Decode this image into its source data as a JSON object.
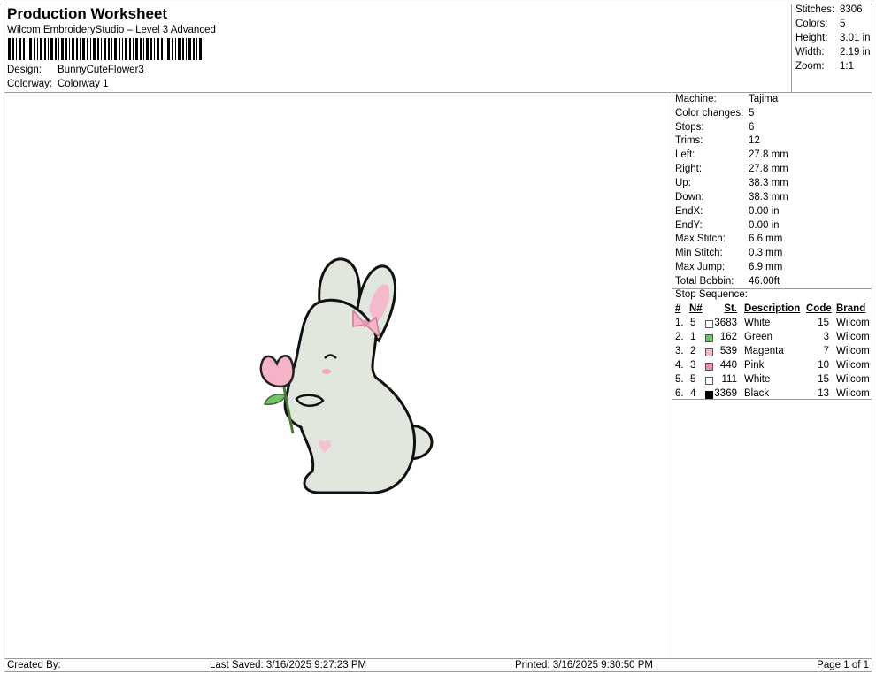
{
  "header": {
    "title": "Production Worksheet",
    "subtitle": "Wilcom EmbroideryStudio – Level 3 Advanced",
    "design_label": "Design:",
    "design_value": "BunnyCuteFlower3",
    "colorway_label": "Colorway:",
    "colorway_value": "Colorway 1"
  },
  "stats": [
    {
      "label": "Stitches:",
      "value": "8306"
    },
    {
      "label": "Colors:",
      "value": "5"
    },
    {
      "label": "Height:",
      "value": "3.01 in"
    },
    {
      "label": "Width:",
      "value": "2.19 in"
    },
    {
      "label": "Zoom:",
      "value": "1:1"
    }
  ],
  "machine_info": [
    {
      "label": "Machine:",
      "value": "Tajima"
    },
    {
      "label": "Color changes:",
      "value": "5"
    },
    {
      "label": "Stops:",
      "value": "6"
    },
    {
      "label": "Trims:",
      "value": "12"
    },
    {
      "label": "Left:",
      "value": "27.8 mm"
    },
    {
      "label": "Right:",
      "value": "27.8 mm"
    },
    {
      "label": "Up:",
      "value": "38.3 mm"
    },
    {
      "label": "Down:",
      "value": "38.3 mm"
    },
    {
      "label": "EndX:",
      "value": "0.00 in"
    },
    {
      "label": "EndY:",
      "value": "0.00 in"
    },
    {
      "label": "Max Stitch:",
      "value": "6.6 mm"
    },
    {
      "label": "Min Stitch:",
      "value": "0.3 mm"
    },
    {
      "label": "Max Jump:",
      "value": "6.9 mm"
    },
    {
      "label": "Total Bobbin:",
      "value": "46.00ft"
    }
  ],
  "stop_sequence": {
    "title": "Stop Sequence:",
    "columns": [
      "#",
      "N#",
      "St.",
      "Description",
      "Code",
      "Brand"
    ],
    "rows": [
      {
        "idx": "1.",
        "n": "5",
        "color": "#ffffff",
        "st": "3683",
        "desc": "White",
        "code": "15",
        "brand": "Wilcom"
      },
      {
        "idx": "2.",
        "n": "1",
        "color": "#6cc36a",
        "st": "162",
        "desc": "Green",
        "code": "3",
        "brand": "Wilcom"
      },
      {
        "idx": "3.",
        "n": "2",
        "color": "#f4b6cf",
        "st": "539",
        "desc": "Magenta",
        "code": "7",
        "brand": "Wilcom"
      },
      {
        "idx": "4.",
        "n": "3",
        "color": "#ee88b4",
        "st": "440",
        "desc": "Pink",
        "code": "10",
        "brand": "Wilcom"
      },
      {
        "idx": "5.",
        "n": "5",
        "color": "#ffffff",
        "st": "111",
        "desc": "White",
        "code": "15",
        "brand": "Wilcom"
      },
      {
        "idx": "6.",
        "n": "4",
        "color": "#000000",
        "st": "3369",
        "desc": "Black",
        "code": "13",
        "brand": "Wilcom"
      }
    ]
  },
  "footer": {
    "created_by": "Created By:",
    "last_saved": "Last Saved: 3/16/2025 9:27:23 PM",
    "printed": "Printed: 3/16/2025 9:30:50 PM",
    "page": "Page 1 of 1"
  }
}
